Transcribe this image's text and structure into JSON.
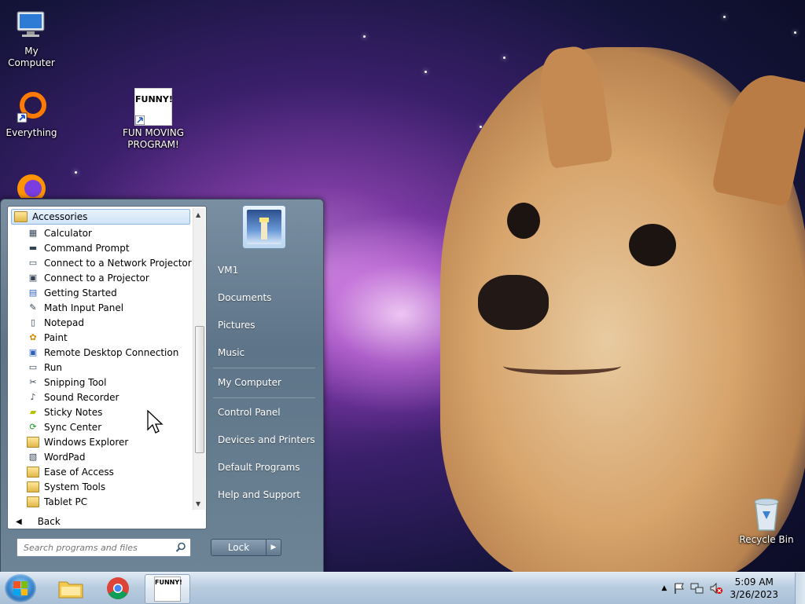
{
  "desktop": {
    "icons": [
      {
        "label": "My Computer",
        "icon": "computer-icon"
      },
      {
        "label": "Everything",
        "icon": "everything-app-icon"
      },
      {
        "label": "FUN MOVING PROGRAM!",
        "icon": "funny-shortcut-icon",
        "thumb_text": "FUNNY!"
      },
      {
        "label": "Recycle Bin",
        "icon": "recycle-bin-icon"
      }
    ]
  },
  "start_menu": {
    "folder_header": "Accessories",
    "programs": [
      {
        "label": "Calculator",
        "icon": "calculator-icon"
      },
      {
        "label": "Command Prompt",
        "icon": "cmd-icon"
      },
      {
        "label": "Connect to a Network Projector",
        "icon": "network-projector-icon"
      },
      {
        "label": "Connect to a Projector",
        "icon": "projector-icon"
      },
      {
        "label": "Getting Started",
        "icon": "getting-started-icon"
      },
      {
        "label": "Math Input Panel",
        "icon": "math-input-icon"
      },
      {
        "label": "Notepad",
        "icon": "notepad-icon"
      },
      {
        "label": "Paint",
        "icon": "paint-icon"
      },
      {
        "label": "Remote Desktop Connection",
        "icon": "remote-desktop-icon"
      },
      {
        "label": "Run",
        "icon": "run-icon"
      },
      {
        "label": "Snipping Tool",
        "icon": "snipping-tool-icon"
      },
      {
        "label": "Sound Recorder",
        "icon": "microphone-icon"
      },
      {
        "label": "Sticky Notes",
        "icon": "sticky-notes-icon"
      },
      {
        "label": "Sync Center",
        "icon": "sync-icon"
      },
      {
        "label": "Windows Explorer",
        "icon": "explorer-folder-icon"
      },
      {
        "label": "WordPad",
        "icon": "wordpad-icon"
      },
      {
        "label": "Ease of Access",
        "icon": "folder-icon"
      },
      {
        "label": "System Tools",
        "icon": "folder-icon"
      },
      {
        "label": "Tablet PC",
        "icon": "folder-icon"
      }
    ],
    "back_label": "Back",
    "search_placeholder": "Search programs and files",
    "right_items": [
      {
        "label": "VM1"
      },
      {
        "label": "Documents"
      },
      {
        "label": "Pictures"
      },
      {
        "label": "Music"
      },
      {
        "label": "My Computer"
      },
      {
        "label": "Control Panel"
      },
      {
        "label": "Devices and Printers"
      },
      {
        "label": "Default Programs"
      },
      {
        "label": "Help and Support"
      }
    ],
    "lock_label": "Lock"
  },
  "taskbar": {
    "pinned": [
      {
        "name": "windows-explorer",
        "icon": "folder-icon"
      },
      {
        "name": "chrome",
        "icon": "chrome-icon"
      },
      {
        "name": "funny-program",
        "icon": "funny-icon",
        "thumb_text": "FUNNY!"
      }
    ],
    "time": "5:09 AM",
    "date": "3/26/2023"
  },
  "colors": {
    "taskbar": "#b9cde0",
    "start_menu": "#6d8496",
    "selection": "#cfe3f8"
  }
}
